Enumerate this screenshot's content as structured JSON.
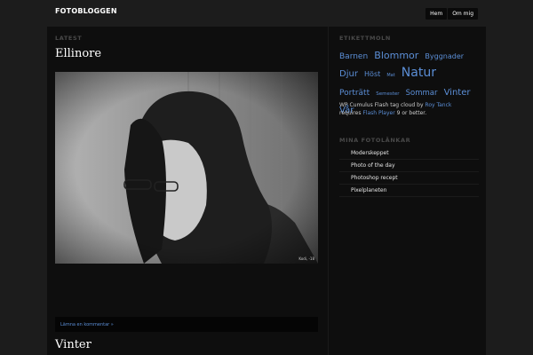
{
  "header": {
    "site_title": "FOTOBLOGGEN",
    "nav": [
      {
        "label": "Hem"
      },
      {
        "label": "Om mig"
      }
    ]
  },
  "main": {
    "section_label": "LATEST",
    "posts": [
      {
        "title": "Ellinore",
        "photo_credit": "Kodi, -18",
        "comment_link": "Lämna en kommentar »"
      },
      {
        "title": "Vinter"
      }
    ]
  },
  "sidebar": {
    "tags_label": "ETIKETTMOLN",
    "tags": [
      {
        "label": "Barnen",
        "size": "9px"
      },
      {
        "label": "Blommor",
        "size": "11px"
      },
      {
        "label": "Byggnader",
        "size": "8px"
      },
      {
        "label": "Djur",
        "size": "10px"
      },
      {
        "label": "Höst",
        "size": "8px"
      },
      {
        "label": "Mat",
        "size": "5px"
      },
      {
        "label": "Natur",
        "size": "14px"
      },
      {
        "label": "Porträtt",
        "size": "9px"
      },
      {
        "label": "Semester",
        "size": "5.5px"
      },
      {
        "label": "Sommar",
        "size": "8.5px"
      },
      {
        "label": "Vinter",
        "size": "10px"
      },
      {
        "label": "Vår",
        "size": "10px"
      }
    ],
    "cumulus_text_1": "WP Cumulus Flash tag cloud by",
    "cumulus_author": "Roy Tanck",
    "cumulus_text_2": "requires",
    "cumulus_flash": "Flash Player",
    "cumulus_text_3": "9 or better.",
    "links_label": "MINA FOTOLÄNKAR",
    "links": [
      {
        "label": "Moderskeppet"
      },
      {
        "label": "Photo of the day"
      },
      {
        "label": "Photoshop recept"
      },
      {
        "label": "Pixelplaneten"
      }
    ]
  },
  "colors": {
    "background": "#1c1c1c",
    "panel": "#0e0e0e",
    "link": "#5b8ed6"
  }
}
